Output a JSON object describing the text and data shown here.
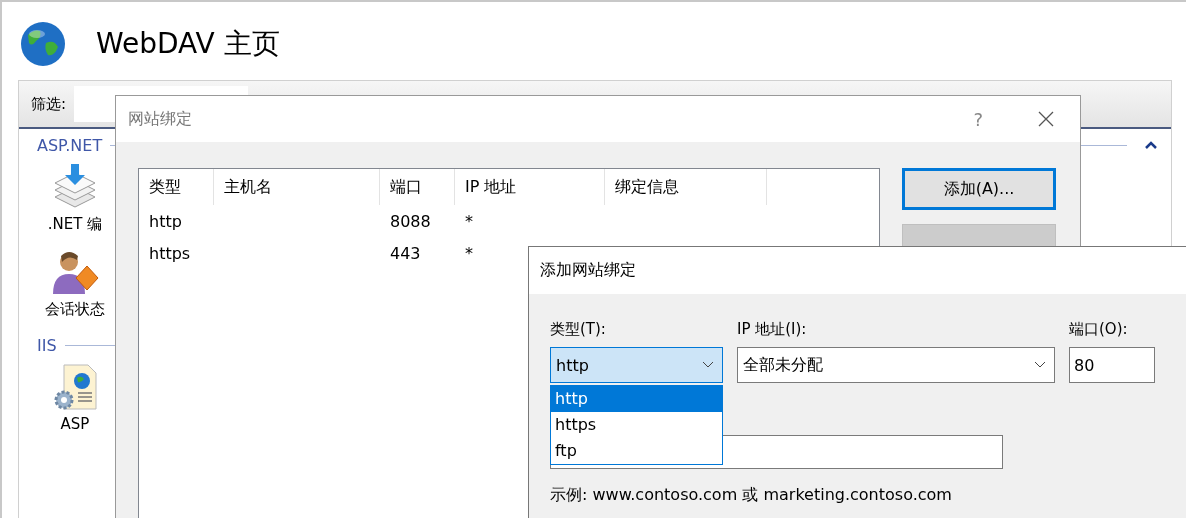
{
  "page": {
    "title": "WebDAV 主页",
    "filter_label": "筛选:",
    "groups": [
      {
        "title": "ASP.NET",
        "items": [
          {
            "label": ".NET 编"
          },
          {
            "label": "会话状态"
          }
        ]
      },
      {
        "title": "IIS",
        "items": [
          {
            "label": "ASP"
          }
        ]
      }
    ]
  },
  "bindings_dialog": {
    "title": "网站绑定",
    "help_glyph": "?",
    "columns": [
      "类型",
      "主机名",
      "端口",
      "IP 地址",
      "绑定信息"
    ],
    "rows": [
      {
        "type": "http",
        "port": "8088",
        "ip": "*"
      },
      {
        "type": "https",
        "port": "443",
        "ip": "*"
      }
    ],
    "buttons": [
      {
        "label": "添加(A)...",
        "focused": true,
        "disabled": false
      },
      {
        "focused": false,
        "disabled": true
      }
    ]
  },
  "add_binding_dialog": {
    "title": "添加网站绑定",
    "type_label": "类型(T):",
    "type_value": "http",
    "type_options": [
      {
        "label": "http",
        "selected": true
      },
      {
        "label": "https",
        "selected": false
      },
      {
        "label": "ftp",
        "selected": false
      }
    ],
    "ip_label": "IP 地址(I):",
    "ip_value": "全部未分配",
    "port_label": "端口(O):",
    "port_value": "80",
    "example": "示例: www.contoso.com 或 marketing.contoso.com"
  }
}
